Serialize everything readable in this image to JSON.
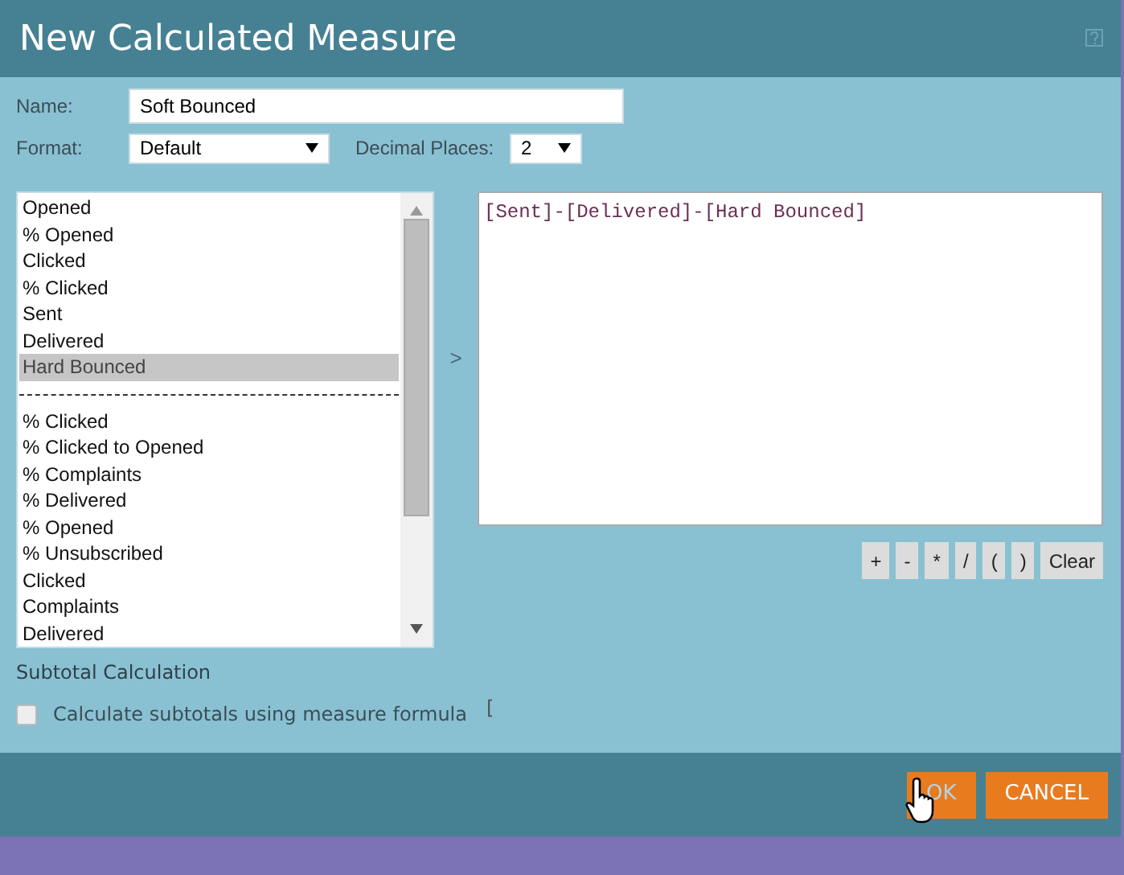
{
  "window": {
    "title": "New Calculated Measure"
  },
  "name_field": {
    "label": "Name:",
    "value": "Soft Bounced"
  },
  "format_field": {
    "label": "Format:",
    "value": "Default"
  },
  "decimal_field": {
    "label": "Decimal Places:",
    "value": "2"
  },
  "measures": [
    {
      "kind": "item",
      "label": "Opened",
      "selected": false
    },
    {
      "kind": "item",
      "label": "% Opened",
      "selected": false
    },
    {
      "kind": "item",
      "label": "Clicked",
      "selected": false
    },
    {
      "kind": "item",
      "label": "% Clicked",
      "selected": false
    },
    {
      "kind": "item",
      "label": "Sent",
      "selected": false
    },
    {
      "kind": "item",
      "label": "Delivered",
      "selected": false
    },
    {
      "kind": "item",
      "label": "Hard Bounced",
      "selected": true
    },
    {
      "kind": "separator"
    },
    {
      "kind": "item",
      "label": "% Clicked",
      "selected": false
    },
    {
      "kind": "item",
      "label": "% Clicked to Opened",
      "selected": false
    },
    {
      "kind": "item",
      "label": "% Complaints",
      "selected": false
    },
    {
      "kind": "item",
      "label": "% Delivered",
      "selected": false
    },
    {
      "kind": "item",
      "label": "% Opened",
      "selected": false
    },
    {
      "kind": "item",
      "label": "% Unsubscribed",
      "selected": false
    },
    {
      "kind": "item",
      "label": "Clicked",
      "selected": false
    },
    {
      "kind": "item",
      "label": "Complaints",
      "selected": false
    },
    {
      "kind": "item",
      "label": "Delivered",
      "selected": false
    }
  ],
  "add_arrow": ">",
  "formula": "[Sent]-[Delivered]-[Hard Bounced]",
  "operators": [
    "+",
    "-",
    "*",
    "/",
    "(",
    ")",
    "Clear"
  ],
  "subtotal": {
    "heading": "Subtotal Calculation",
    "label": "Calculate subtotals using measure formula",
    "checked": false,
    "stray_text": "["
  },
  "buttons": [
    {
      "label": "OK",
      "pressed": true
    },
    {
      "label": "CANCEL",
      "pressed": false
    }
  ]
}
